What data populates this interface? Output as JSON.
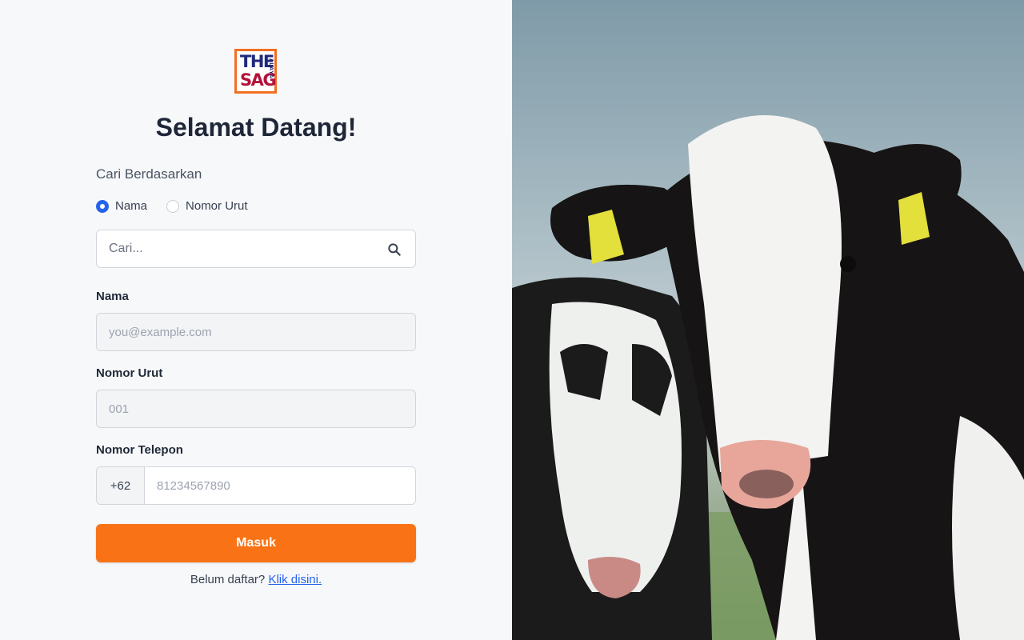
{
  "brand": {
    "logo_line1": "THE",
    "logo_line2": "SAG",
    "logo_side": "ALAYA",
    "accent_color": "#f97316",
    "link_color": "#2563eb"
  },
  "welcome_title": "Selamat Datang!",
  "search": {
    "label": "Cari Berdasarkan",
    "options": [
      {
        "label": "Nama",
        "checked": true
      },
      {
        "label": "Nomor Urut",
        "checked": false
      }
    ],
    "placeholder": "Cari...",
    "icon": "search-icon"
  },
  "form": {
    "name_label": "Nama",
    "name_placeholder": "you@example.com",
    "number_label": "Nomor Urut",
    "number_placeholder": "001",
    "phone_label": "Nomor Telepon",
    "phone_prefix": "+62",
    "phone_placeholder": "81234567890",
    "submit_label": "Masuk"
  },
  "register": {
    "prompt": "Belum daftar?",
    "link": "Klik disini."
  }
}
